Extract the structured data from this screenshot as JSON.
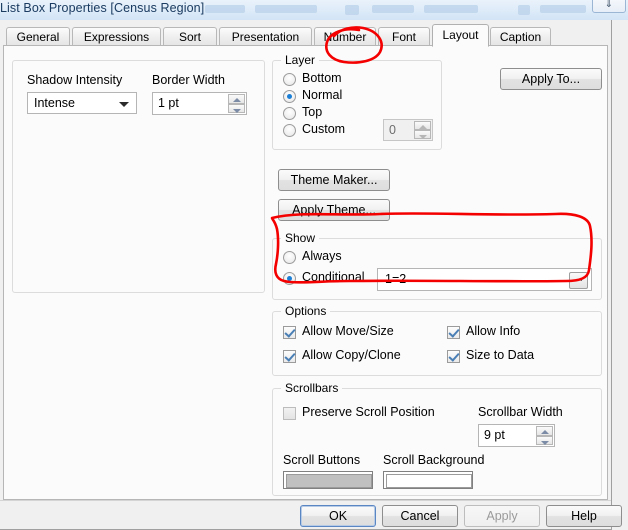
{
  "background_window": {
    "title": "List Box Properties [Census Region]",
    "minimize_glyph": "⇓"
  },
  "dialog": {
    "tabs": [
      {
        "label": "General",
        "active": false
      },
      {
        "label": "Expressions",
        "active": false
      },
      {
        "label": "Sort",
        "active": false
      },
      {
        "label": "Presentation",
        "active": false
      },
      {
        "label": "Number",
        "active": false
      },
      {
        "label": "Font",
        "active": false
      },
      {
        "label": "Layout",
        "active": true
      },
      {
        "label": "Caption",
        "active": false
      }
    ],
    "left_panel": {
      "shadow_intensity": {
        "label": "Shadow Intensity",
        "value": "Intense"
      },
      "border_width": {
        "label": "Border Width",
        "value": "1 pt"
      }
    },
    "layer_group": {
      "title": "Layer",
      "options": [
        {
          "label": "Bottom",
          "selected": false
        },
        {
          "label": "Normal",
          "selected": true
        },
        {
          "label": "Top",
          "selected": false
        },
        {
          "label": "Custom",
          "selected": false
        }
      ],
      "custom_value": "0"
    },
    "theme_buttons": {
      "theme_maker": "Theme Maker...",
      "apply_theme": "Apply Theme..."
    },
    "apply_to_button": "Apply To...",
    "show_group": {
      "title": "Show",
      "options": [
        {
          "label": "Always",
          "selected": false
        },
        {
          "label": "Conditional",
          "selected": true
        }
      ],
      "condition_value": "1=2",
      "condition_browse": "..."
    },
    "options_group": {
      "title": "Options",
      "items": [
        {
          "label": "Allow Move/Size",
          "checked": true
        },
        {
          "label": "Allow Info",
          "checked": true
        },
        {
          "label": "Allow Copy/Clone",
          "checked": true
        },
        {
          "label": "Size to Data",
          "checked": true
        }
      ]
    },
    "scrollbars_group": {
      "title": "Scrollbars",
      "preserve_scroll_position": {
        "label": "Preserve Scroll Position",
        "checked": false
      },
      "scrollbar_width": {
        "label": "Scrollbar Width",
        "value": "9 pt"
      },
      "scroll_buttons": {
        "label": "Scroll Buttons",
        "color": "#c0c0c0"
      },
      "scroll_background": {
        "label": "Scroll Background",
        "color": "#ffffff"
      }
    },
    "footer_buttons": [
      {
        "label": "OK",
        "enabled": true,
        "default": true
      },
      {
        "label": "Cancel",
        "enabled": true,
        "default": false
      },
      {
        "label": "Apply",
        "enabled": false,
        "default": false
      },
      {
        "label": "Help",
        "enabled": true,
        "default": false
      }
    ]
  },
  "annotations": {
    "color": "#f40000",
    "marks": [
      "circle-around-layout-tab",
      "rounded-box-around-show-group"
    ]
  }
}
